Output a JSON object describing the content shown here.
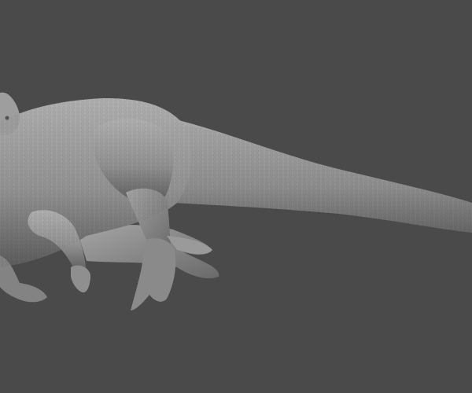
{
  "scene": {
    "subject": "dinosaur-sculpt",
    "colors": {
      "background": "#4a4a4a",
      "skin_light": "#a8a8a8",
      "skin_mid": "#8c8c8c",
      "skin_dark": "#5e5e5e"
    }
  }
}
